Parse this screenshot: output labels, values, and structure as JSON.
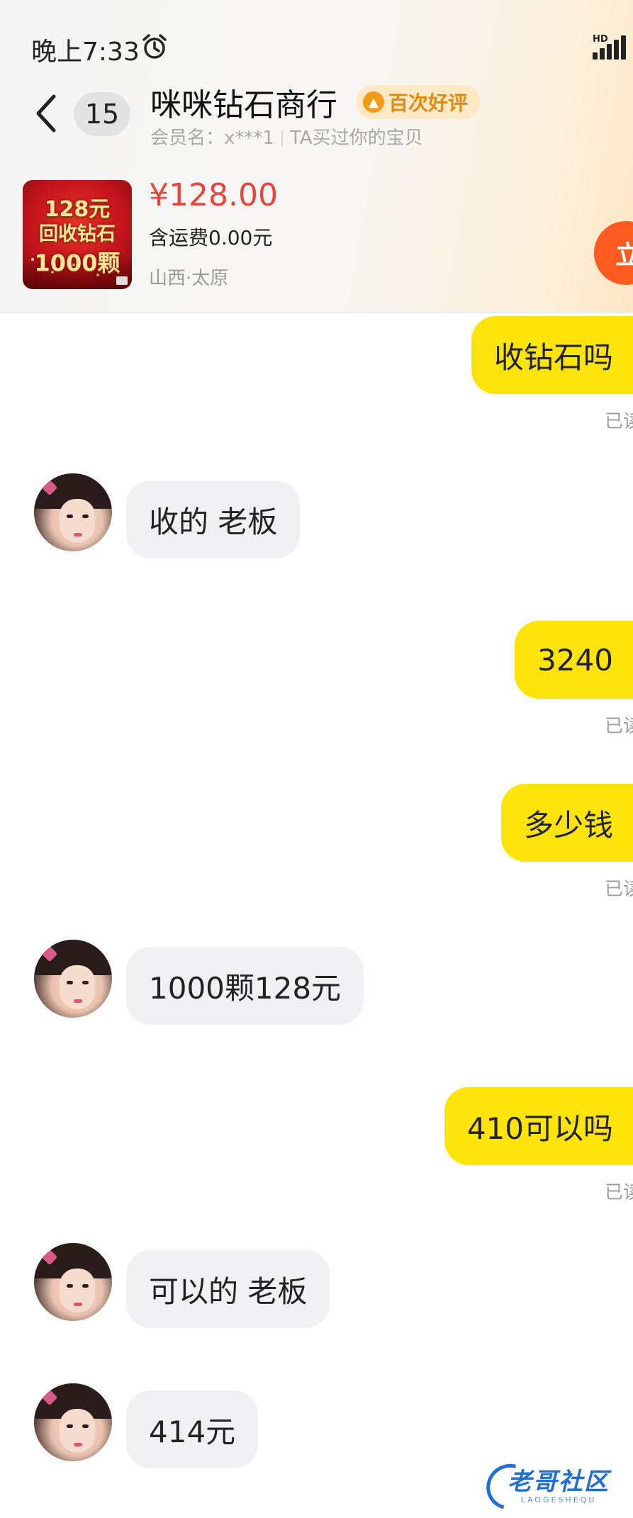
{
  "status_bar": {
    "time": "晚上7:33",
    "alarm_icon": "alarm-clock-icon",
    "network_label": "HD",
    "signal_icon": "signal-bars-icon"
  },
  "header": {
    "back_icon": "chevron-left-icon",
    "unread_count": "15",
    "shop_name": "咪咪钻石商行",
    "review_badge": "百次好评",
    "member_label": "会员名：x***1",
    "relation_text": "TA买过你的宝贝"
  },
  "product": {
    "thumbnail_text": [
      "128元",
      "回收钻石",
      "1000颗"
    ],
    "price": "¥128.00",
    "shipping": "含运费0.00元",
    "location": "山西·太原",
    "buy_label": "立"
  },
  "messages": [
    {
      "from": "me",
      "text": "收钻石吗",
      "status": "已读"
    },
    {
      "from": "them",
      "text": "收的  老板"
    },
    {
      "from": "me",
      "text": "3240",
      "status": "已读"
    },
    {
      "from": "me",
      "text": "多少钱",
      "status": "已读"
    },
    {
      "from": "them",
      "text": "1000颗128元"
    },
    {
      "from": "me",
      "text": "410可以吗",
      "status": "已读"
    },
    {
      "from": "them",
      "text": "可以的  老板"
    },
    {
      "from": "them",
      "text": "414元"
    }
  ],
  "watermark": {
    "main": "老哥社区",
    "sub": "LAOGESHEQU"
  },
  "colors": {
    "my_bubble": "#ffe40c",
    "their_bubble": "#f1f1f3",
    "price": "#e8453c",
    "badge_text": "#e08a10",
    "buy_button": "#ff5a1f"
  }
}
